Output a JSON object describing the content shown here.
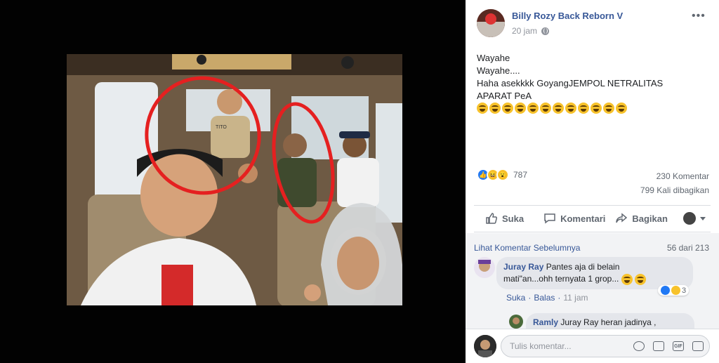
{
  "post": {
    "author": "Billy Rozy Back Reborn V",
    "time": "20 jam",
    "lines": [
      "Wayahe",
      "Wayahe....",
      "Haha asekkkk GoyangJEMPOL NETRALITAS",
      "APARAT PeA"
    ],
    "emoji_count": 12,
    "emoji_name": "grinning-face-emoji",
    "reaction_count": "787",
    "comments_count": "230 Komentar",
    "shares_count": "799 Kali dibagikan",
    "photo_caption": "TITO"
  },
  "actions": {
    "like": "Suka",
    "comment": "Komentari",
    "share": "Bagikan"
  },
  "comments": {
    "prev_link": "Lihat Komentar Sebelumnya",
    "pager": "56 dari 213",
    "items": [
      {
        "name": "Juray Ray",
        "text": "Pantes aja di belain",
        "text2": "mati\"an...ohh ternyata 1 grop...",
        "reaction_count": "3",
        "like_label": "Suka",
        "reply_label": "Balas",
        "time": "11 jam"
      },
      {
        "name": "Ramly",
        "text": "Juray Ray heran jadinya ,"
      }
    ]
  },
  "composer": {
    "placeholder": "Tulis komentar...",
    "gif_label": "GIF"
  },
  "colors": {
    "link": "#385898",
    "like_blue": "#2078f4",
    "circle_red": "#e52020"
  }
}
